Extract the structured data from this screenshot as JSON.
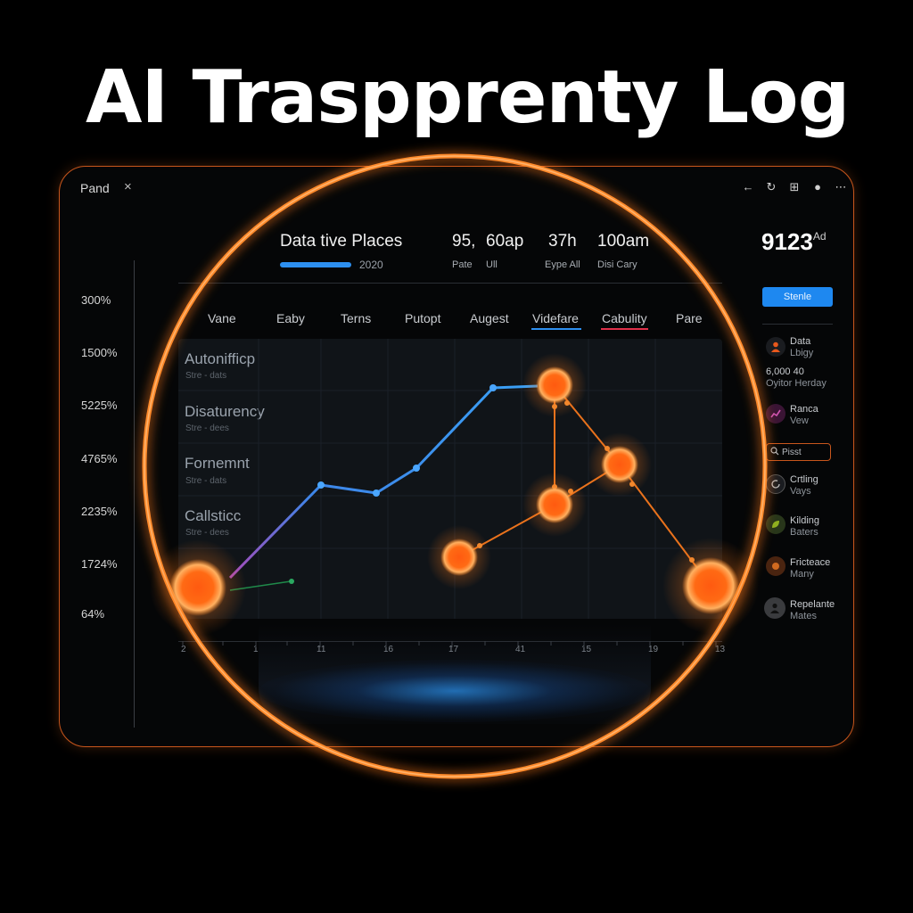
{
  "hero_title": "AI Traspprenty Log",
  "window": {
    "title": "Pand",
    "close_glyph": "×",
    "controls": [
      "←",
      "↻",
      "⊞",
      "●",
      "⋯"
    ]
  },
  "header": {
    "label": "Data tive Places",
    "year": "2020",
    "stats": [
      {
        "value": "95,",
        "sub": "Pate"
      },
      {
        "value": "60ap",
        "sub": "Ull"
      },
      {
        "value": "37h",
        "sub": "Eype All"
      },
      {
        "value": "100am",
        "sub": "Disi Cary"
      }
    ]
  },
  "tabs": [
    "Vane",
    "Eaby",
    "Terns",
    "Putopt",
    "Augest",
    "Videfare",
    "Cabulity",
    "Pare"
  ],
  "rows": [
    {
      "title": "Autonifficp",
      "sub": "Stre - dats"
    },
    {
      "title": "Disaturency",
      "sub": "Stre - dees"
    },
    {
      "title": "Fornemnt",
      "sub": "Stre - dats"
    },
    {
      "title": "Callsticc",
      "sub": "Stre - dees"
    }
  ],
  "y_ticks": [
    "300%",
    "1500%",
    "5225%",
    "4765%",
    "2235%",
    "1724%",
    "64%"
  ],
  "x_ticks": [
    "2",
    "1",
    "11",
    "16",
    "17",
    "41",
    "15",
    "19",
    "13"
  ],
  "side": {
    "big_value": "9123",
    "big_value_sup": "Ad",
    "start_button": "Stenle",
    "items": [
      {
        "icon": "person-icon",
        "line1": "Data",
        "line2": "Lbigy",
        "color": "#e8581c"
      },
      {
        "icon": "none",
        "line1": "6,000 40",
        "line2": "Oyitor Herday",
        "color": ""
      },
      {
        "icon": "chart-icon",
        "line1": "Ranca",
        "line2": "Vew",
        "color": "#a33a8a"
      },
      {
        "icon": "refresh-icon",
        "line1": "Crtling",
        "line2": "Vays",
        "color": "#7a7f86"
      },
      {
        "icon": "leaf-icon",
        "line1": "Kilding",
        "line2": "Baters",
        "color": "#8fb020"
      },
      {
        "icon": "dot-icon",
        "line1": "Fricteace",
        "line2": "Many",
        "color": "#d06a20"
      },
      {
        "icon": "user-icon",
        "line1": "Repelante",
        "line2": "Mates",
        "color": "#6d6f73"
      }
    ],
    "search_label": "Pisst"
  },
  "colors": {
    "accent_orange": "#ff7a1a",
    "accent_blue": "#2d8ff0",
    "tab_blue": "#2d8ff0",
    "tab_red": "#e0304a"
  }
}
